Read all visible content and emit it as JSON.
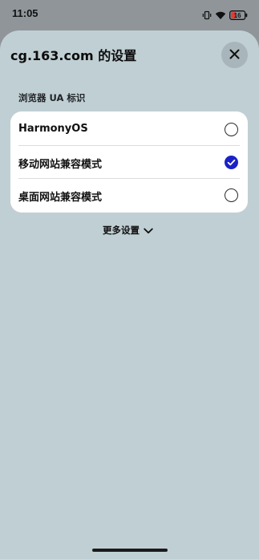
{
  "status_bar": {
    "time": "11:05",
    "battery_level": "16",
    "icons": [
      "vibrate-icon",
      "wifi-icon",
      "battery-icon"
    ]
  },
  "sheet": {
    "title": "cg.163.com 的设置",
    "close_icon": "close-icon"
  },
  "ua_section": {
    "label": "浏览器 UA 标识",
    "options": [
      {
        "label": "HarmonyOS",
        "selected": false
      },
      {
        "label": "移动网站兼容模式",
        "selected": true
      },
      {
        "label": "桌面网站兼容模式",
        "selected": false
      }
    ]
  },
  "more_settings": {
    "label": "更多设置",
    "icon": "chevron-down-icon"
  },
  "colors": {
    "accent": "#1a21c7",
    "sheet_background": "#c0cfd4",
    "battery_alert": "#e53935"
  }
}
